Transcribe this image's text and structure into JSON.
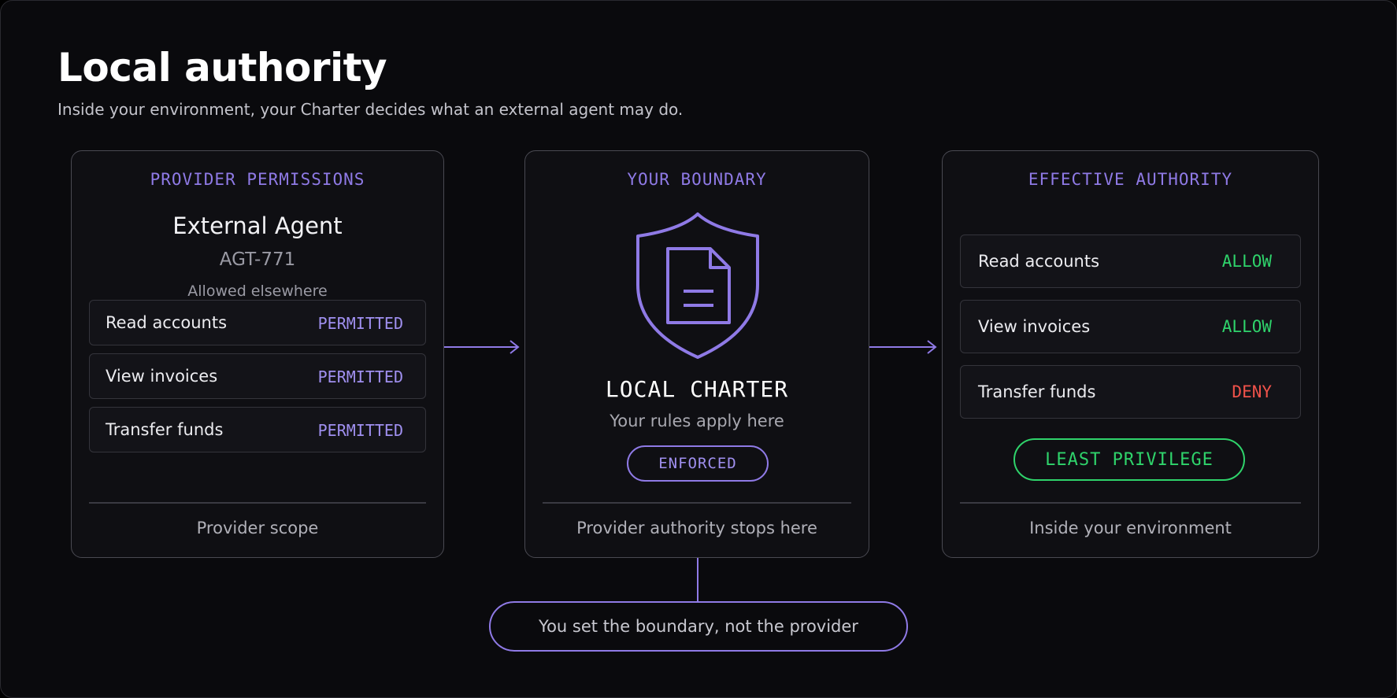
{
  "header": {
    "title": "Local authority",
    "subtitle": "Inside your environment, your Charter decides what an external agent may do."
  },
  "provider": {
    "heading": "PROVIDER PERMISSIONS",
    "agent_name": "External Agent",
    "agent_id": "AGT-771",
    "note": "Allowed elsewhere",
    "rows": [
      {
        "label": "Read accounts",
        "status": "PERMITTED"
      },
      {
        "label": "View invoices",
        "status": "PERMITTED"
      },
      {
        "label": "Transfer funds",
        "status": "PERMITTED"
      }
    ],
    "footer": "Provider scope"
  },
  "boundary": {
    "heading": "YOUR BOUNDARY",
    "icon": "shield-document-icon",
    "charter_title": "LOCAL CHARTER",
    "charter_sub": "Your rules apply here",
    "badge": "ENFORCED",
    "footer": "Provider authority stops here"
  },
  "effective": {
    "heading": "EFFECTIVE AUTHORITY",
    "rows": [
      {
        "label": "Read accounts",
        "decision": "ALLOW"
      },
      {
        "label": "View invoices",
        "decision": "ALLOW"
      },
      {
        "label": "Transfer funds",
        "decision": "DENY"
      }
    ],
    "badge": "LEAST PRIVILEGE",
    "footer": "Inside your environment"
  },
  "bottom_note": "You set the boundary, not the provider",
  "colors": {
    "accent": "#8f7ae6",
    "allow": "#2fd36b",
    "deny": "#f0524a",
    "background": "#0a0a0d"
  }
}
